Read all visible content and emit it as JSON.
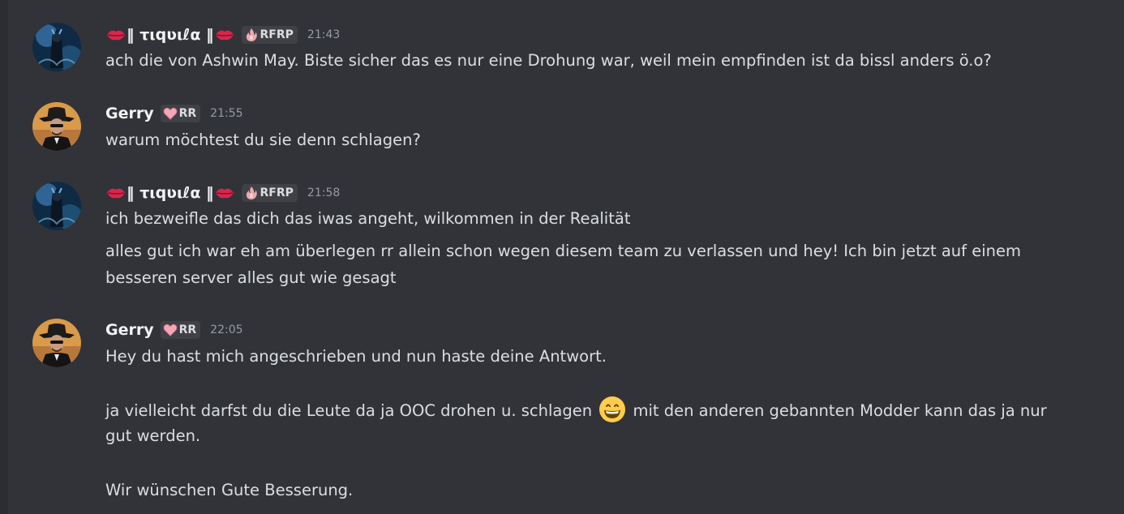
{
  "messages": [
    {
      "author": "‖ τιqʋιℓα ‖",
      "tag": "RFRP",
      "time": "21:43",
      "lines": [
        "ach die von Ashwin May. Biste sicher das es nur eine Drohung war, weil mein empfinden ist da bissl anders ö.o?"
      ]
    },
    {
      "author": "Gerry",
      "tag": "RR",
      "time": "21:55",
      "lines": [
        "warum möchtest du sie denn schlagen?"
      ]
    },
    {
      "author": "‖ τιqʋιℓα ‖",
      "tag": "RFRP",
      "time": "21:58",
      "lines": [
        "ich bezweifle das dich das iwas angeht, wilkommen in der Realität",
        "alles gut ich war eh am überlegen rr allein schon wegen diesem team zu verlassen und hey! Ich bin jetzt auf einem",
        "besseren server alles gut wie gesagt"
      ]
    },
    {
      "author": "Gerry",
      "tag": "RR",
      "time": "22:05",
      "lines": [
        "Hey du hast mich angeschrieben und nun haste deine Antwort.",
        "ja vielleicht darfst du die Leute da ja OOC drohen u. schlagen",
        "mit den anderen gebannten Modder kann das ja nur",
        "gut werden.",
        "Wir wünschen Gute Besserung."
      ]
    }
  ],
  "colors": {
    "background": "#313338",
    "username": "#f2f3f5",
    "text": "#dbdee1",
    "timestamp": "#949ba4",
    "tag_bg": "#3f4147"
  },
  "icons": {
    "lips": "lips-emoji-icon",
    "fire": "fire-icon",
    "heart": "heart-icon",
    "grin": "grinning-emoji-icon"
  }
}
